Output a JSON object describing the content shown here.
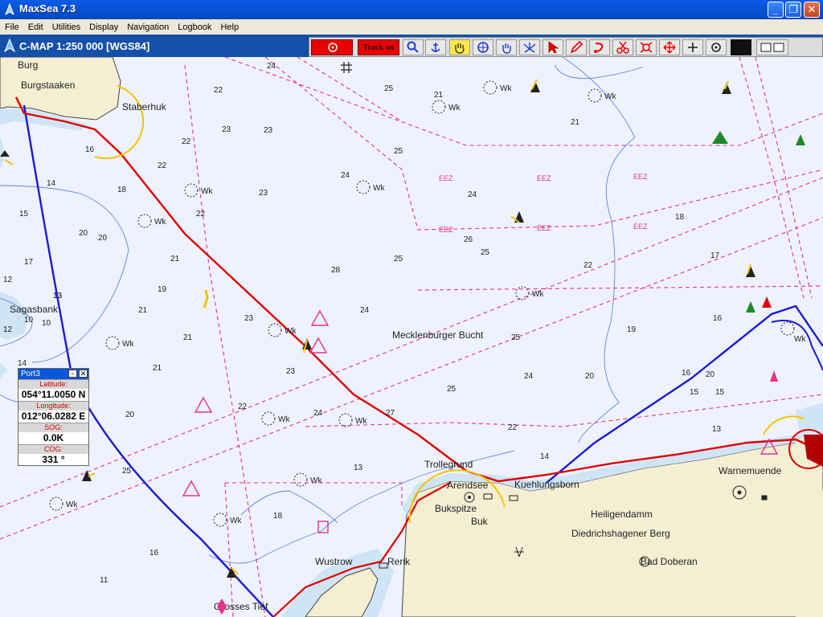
{
  "window": {
    "title": "MaxSea 7.3"
  },
  "menu": [
    "File",
    "Edit",
    "Utilities",
    "Display",
    "Navigation",
    "Logbook",
    "Help"
  ],
  "chart": {
    "title": "C-MAP  1:250 000 [WGS84]",
    "track_label": "Track on",
    "tools": [
      "stop-target",
      "track-toggle",
      "zoom",
      "anchor",
      "hand-pan",
      "target",
      "grab",
      "compass-rose",
      "pointer",
      "pencil",
      "route",
      "scissors",
      "waypoint-group",
      "move",
      "plus",
      "center-point"
    ]
  },
  "places": [
    {
      "id": "burg",
      "text": "Burg"
    },
    {
      "id": "burgstaaken",
      "text": "Burgstaaken"
    },
    {
      "id": "staberhuk",
      "text": "Staberhuk"
    },
    {
      "id": "sagasbank",
      "text": "Sagasbank"
    },
    {
      "id": "mecklenburger-bucht",
      "text": "Mecklenburger Bucht"
    },
    {
      "id": "warnemuende",
      "text": "Warnemuende"
    },
    {
      "id": "heiligendamm",
      "text": "Heiligendamm"
    },
    {
      "id": "diedrichshagener-berg",
      "text": "Diedrichshagener Berg"
    },
    {
      "id": "bad-doberan",
      "text": "Bad Doberan"
    },
    {
      "id": "arendsee",
      "text": "Arendsee"
    },
    {
      "id": "kuehlungsborn",
      "text": "Kuehlungsborn"
    },
    {
      "id": "bukspitze",
      "text": "Bukspitze"
    },
    {
      "id": "buk",
      "text": "Buk"
    },
    {
      "id": "wustrow",
      "text": "Wustrow"
    },
    {
      "id": "rerik",
      "text": "Rerik"
    },
    {
      "id": "grosses-tief",
      "text": "Grosses Tief"
    },
    {
      "id": "trollegrund",
      "text": "Trollegrund"
    }
  ],
  "zone_labels": [
    "EEZ",
    "EEZ",
    "EEZ",
    "EEZ",
    "EEZ",
    "EEZ"
  ],
  "depths": [
    "24",
    "25",
    "22",
    "23",
    "22",
    "22",
    "21",
    "23",
    "25",
    "24",
    "21",
    "22",
    "16",
    "14",
    "18",
    "15",
    "20",
    "17",
    "13",
    "12",
    "10",
    "21",
    "21",
    "21",
    "23",
    "24",
    "28",
    "24",
    "25",
    "25",
    "24",
    "25",
    "22",
    "23",
    "20",
    "20",
    "19",
    "17",
    "16",
    "15",
    "13",
    "21",
    "19",
    "18",
    "16",
    "20",
    "22",
    "23",
    "25",
    "27",
    "24",
    "26",
    "25",
    "22",
    "20",
    "18",
    "16",
    "15",
    "14",
    "12",
    "13",
    "11",
    "10",
    "14",
    "13"
  ],
  "wrecks": [
    "Wk",
    "Wk",
    "Wk",
    "Wk",
    "Wk",
    "Wk",
    "Wk",
    "Wk",
    "Wk",
    "Wk",
    "Wk",
    "Wk",
    "Wk",
    "Wk",
    "Wk"
  ],
  "port_panel": {
    "title": "Port3",
    "latitude_label": "Latitude:",
    "latitude": "054°11.0050 N",
    "longitude_label": "Longitude:",
    "longitude": "012°06.0282 E",
    "sog_label": "SOG:",
    "sog": "0.0K",
    "cog_label": "COG:",
    "cog": "331 °"
  },
  "colors": {
    "sea": "#eef2ff",
    "land": "#f4eed2",
    "shallow": "#cfe4f5",
    "track": "#e00000",
    "route": "#1a1ad8",
    "zone": "#e8308c"
  }
}
